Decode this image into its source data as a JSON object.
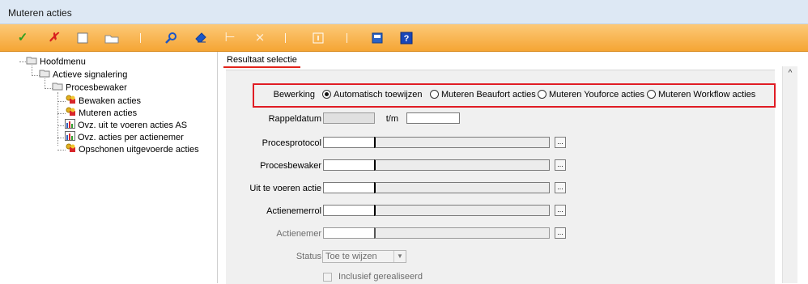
{
  "window": {
    "title": "Muteren acties"
  },
  "toolbar": {
    "icons": [
      "check-icon",
      "cross-icon",
      "new-document-icon",
      "folder-icon",
      "search-icon",
      "eraser-icon",
      "insert-row-icon",
      "delete-row-icon",
      "info-icon",
      "calculator-icon",
      "help-icon"
    ],
    "colors": {
      "check": "#2e9e1f",
      "cross": "#d81e1e",
      "search": "#1b56c6",
      "help": "#1846b8"
    }
  },
  "tree": {
    "root": "Hoofdmenu",
    "level1": "Actieve signalering",
    "level2": "Procesbewaker",
    "items": [
      "Bewaken acties",
      "Muteren acties",
      "Ovz. uit te voeren acties AS",
      "Ovz. acties per actienemer",
      "Opschonen uitgevoerde acties"
    ]
  },
  "tab": {
    "label": "Resultaat selectie"
  },
  "form": {
    "bewerking_label": "Bewerking",
    "options": [
      "Automatisch toewijzen",
      "Muteren Beaufort acties",
      "Muteren Youforce acties",
      "Muteren Workflow acties"
    ],
    "selected_option": "Automatisch toewijzen",
    "rappeldatum_label": "Rappeldatum",
    "tm_label": "t/m",
    "lookup_fields": [
      "Procesprotocol",
      "Procesbewaker",
      "Uit te voeren actie",
      "Actienemerrol",
      "Actienemer"
    ],
    "lookup_button": "...",
    "status_label": "Status",
    "status_value": "Toe te wijzen",
    "inclusief_label": "Inclusief gerealiseerd"
  }
}
